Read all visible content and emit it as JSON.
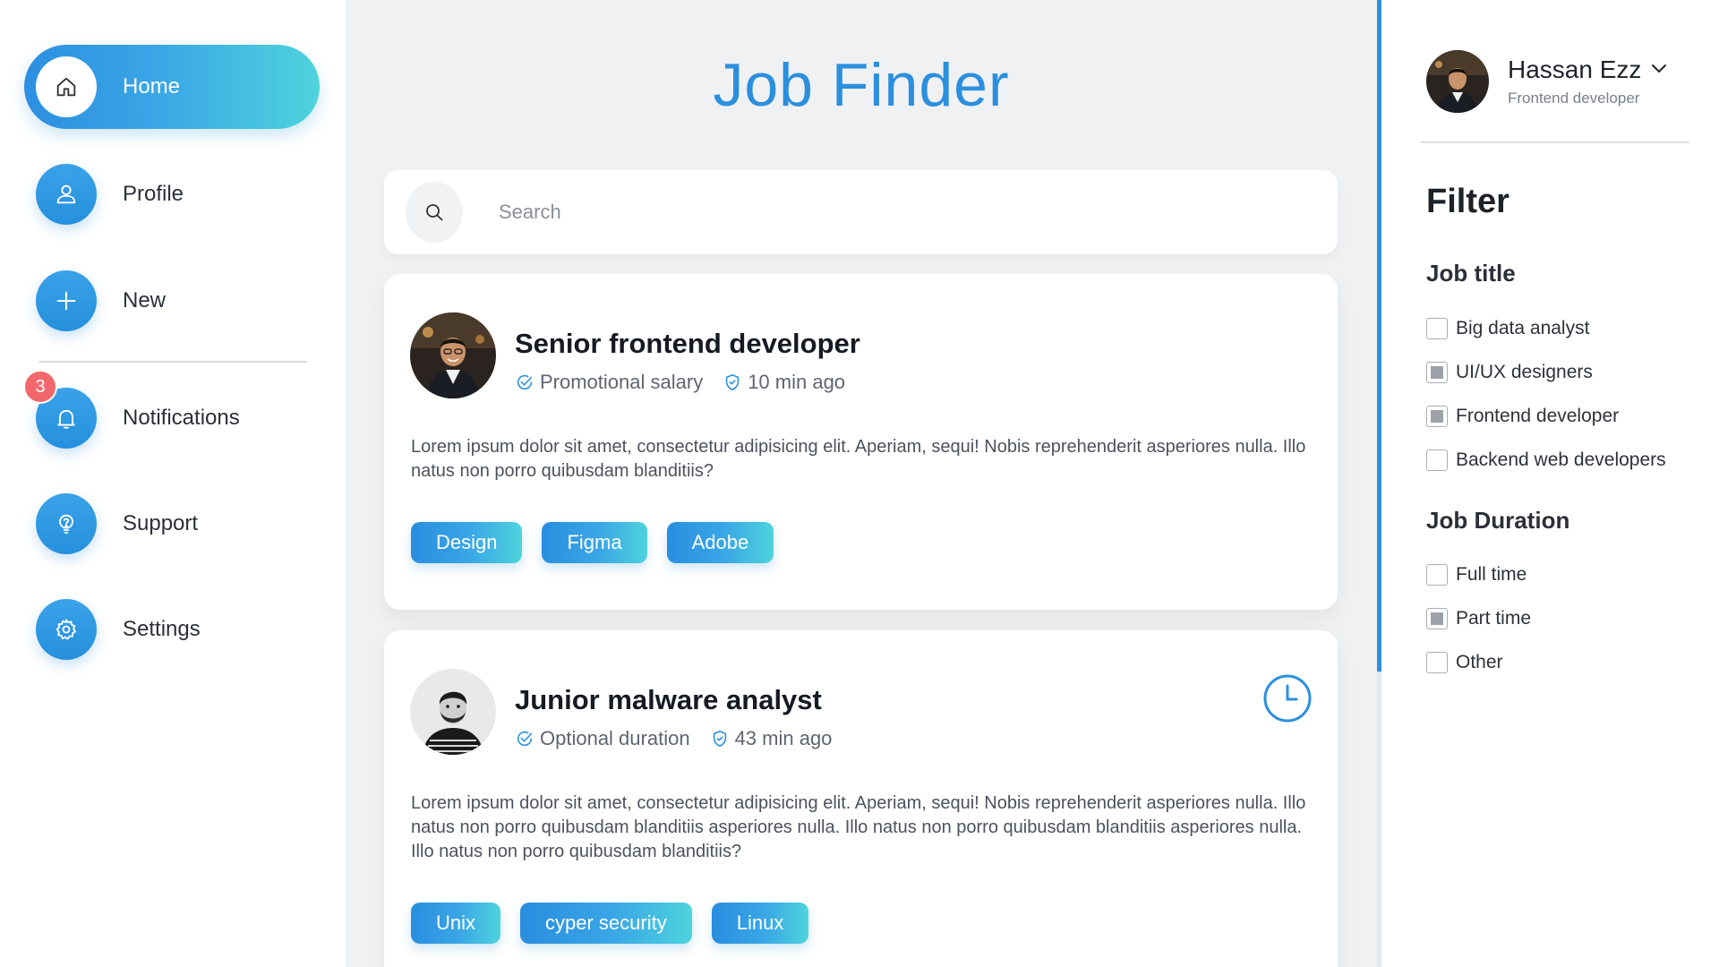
{
  "app": {
    "title": "Job Finder"
  },
  "sidebar": {
    "items": [
      {
        "label": "Home",
        "icon": "home-icon",
        "active": true
      },
      {
        "label": "Profile",
        "icon": "user-icon",
        "active": false
      },
      {
        "label": "New",
        "icon": "plus-icon",
        "active": false
      },
      {
        "label": "Notifications",
        "icon": "bell-icon",
        "active": false,
        "badge": "3"
      },
      {
        "label": "Support",
        "icon": "help-icon",
        "active": false
      },
      {
        "label": "Settings",
        "icon": "gear-icon",
        "active": false
      }
    ]
  },
  "search": {
    "placeholder": "Search",
    "value": ""
  },
  "jobs": [
    {
      "title": "Senior frontend developer",
      "meta_1": "Promotional salary",
      "meta_2": "10 min ago",
      "description": "Lorem ipsum dolor sit amet, consectetur adipisicing elit. Aperiam, sequi! Nobis reprehenderit asperiores nulla. Illo natus non porro quibusdam blanditiis?",
      "tags": [
        "Design",
        "Figma",
        "Adobe"
      ]
    },
    {
      "title": "Junior malware analyst",
      "meta_1": "Optional duration",
      "meta_2": "43 min ago",
      "description": "Lorem ipsum dolor sit amet, consectetur adipisicing elit. Aperiam, sequi! Nobis reprehenderit asperiores nulla. Illo natus non porro quibusdam blanditiis asperiores nulla. Illo natus non porro quibusdam blanditiis asperiores nulla. Illo natus non porro quibusdam blanditiis?",
      "tags": [
        "Unix",
        "cyper security",
        "Linux"
      ]
    }
  ],
  "user": {
    "name": "Hassan Ezz",
    "role": "Frontend developer"
  },
  "filter": {
    "title": "Filter",
    "job_title": {
      "heading": "Job title",
      "options": [
        {
          "label": "Big data analyst",
          "checked": false
        },
        {
          "label": "UI/UX designers",
          "checked": true
        },
        {
          "label": "Frontend developer",
          "checked": true
        },
        {
          "label": "Backend web developers",
          "checked": false
        }
      ]
    },
    "job_duration": {
      "heading": "Job Duration",
      "options": [
        {
          "label": "Full time",
          "checked": false
        },
        {
          "label": "Part time",
          "checked": true
        },
        {
          "label": "Other",
          "checked": false
        }
      ]
    }
  },
  "colors": {
    "accent": "#2b8fde",
    "accent_gradient_end": "#4fd3dc",
    "badge": "#f2676b",
    "background": "#f0f1f3"
  }
}
